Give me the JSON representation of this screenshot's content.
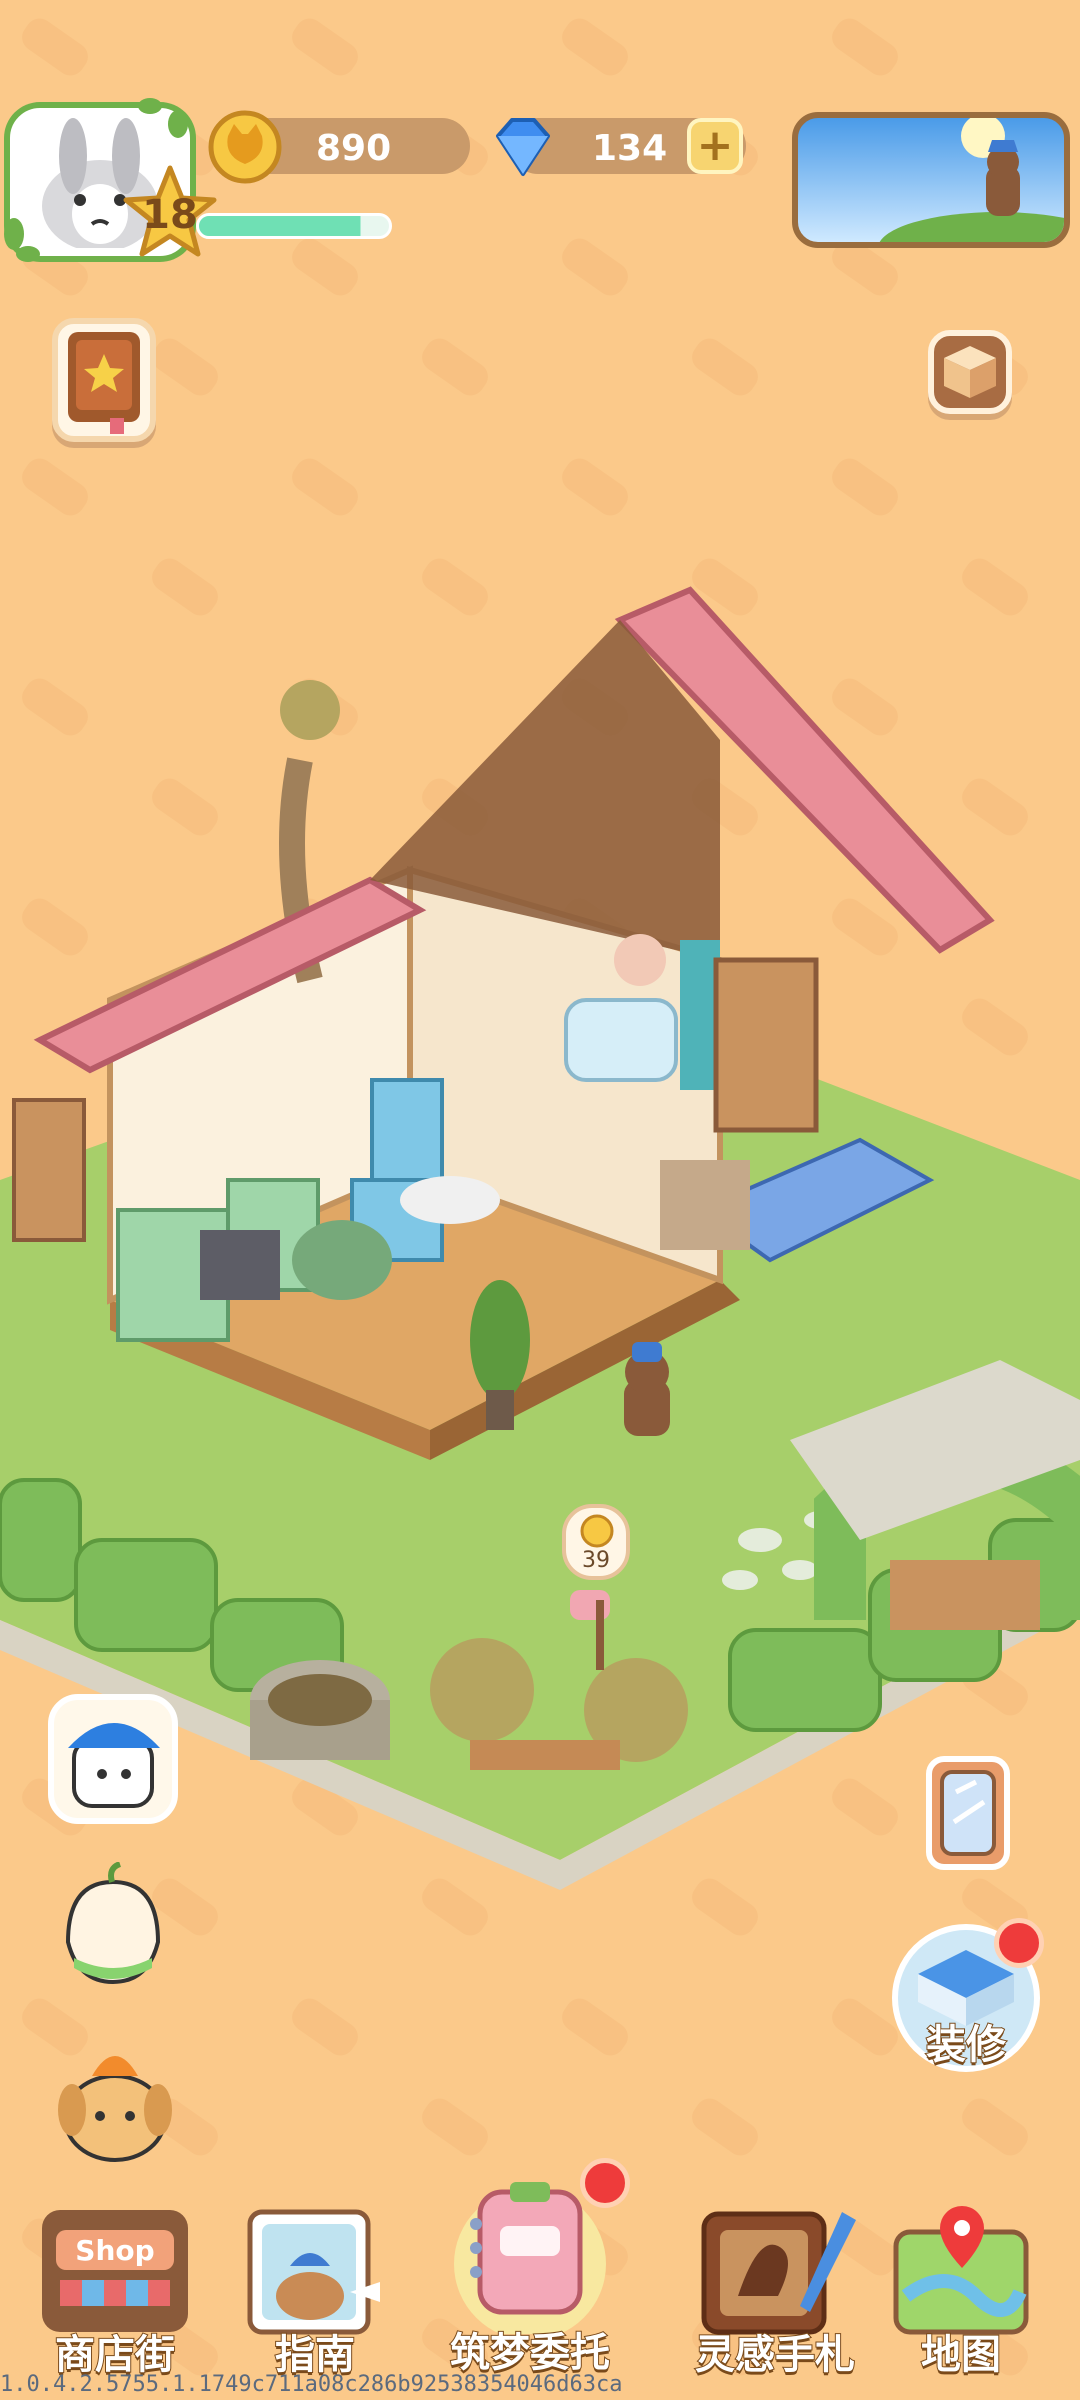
{
  "hud": {
    "level": "18",
    "coins": "890",
    "gems": "134",
    "plus_label": "+",
    "xp_progress": 0.85
  },
  "scene": {
    "coin_bubble_value": "39"
  },
  "side_buttons": {
    "renovate_label": "装修"
  },
  "bottom_nav": [
    {
      "label": "商店街",
      "icon": "shop-icon",
      "sign": "Shop"
    },
    {
      "label": "指南",
      "icon": "guide-book-icon"
    },
    {
      "label": "筑梦委托",
      "icon": "commission-notebook-icon"
    },
    {
      "label": "灵感手札",
      "icon": "inspiration-journal-icon"
    },
    {
      "label": "地图",
      "icon": "map-icon"
    }
  ],
  "version_text": "1.0.4.2.5755.1.1749c711a08c286b92538354046d63ca",
  "colors": {
    "background": "#fbc98a",
    "accent_green": "#6fb14a",
    "badge_red": "#ee3b3b",
    "roof_pink": "#e98e98"
  }
}
